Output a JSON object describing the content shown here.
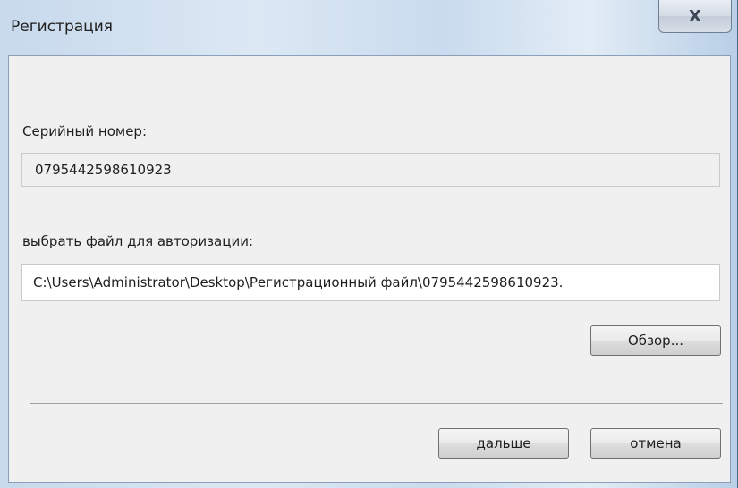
{
  "window": {
    "title": "Регистрация",
    "close_glyph": "X",
    "close_icon": "close-icon"
  },
  "serial": {
    "label": "Серийный номер:",
    "value": "0795442598610923"
  },
  "auth_file": {
    "label": "выбрать файл для авторизации:",
    "value": "C:\\Users\\Administrator\\Desktop\\Регистрационный файл\\0795442598610923."
  },
  "buttons": {
    "browse": "Обзор...",
    "next": "дальше",
    "cancel": "отмена"
  }
}
